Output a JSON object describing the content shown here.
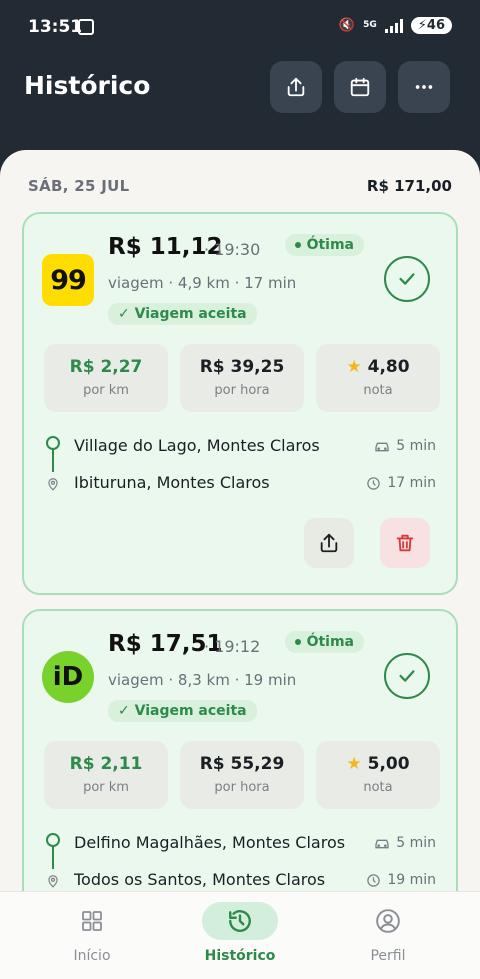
{
  "status_bar": {
    "time": "13:51",
    "network": "5G",
    "battery": "46"
  },
  "header": {
    "title": "Histórico",
    "share_icon": "share-icon",
    "calendar_icon": "calendar-icon",
    "more_icon": "more-horizontal-icon"
  },
  "day": {
    "label": "SÁB, 25 JUL",
    "total": "R$ 171,00"
  },
  "trips": [
    {
      "logo_text": "99",
      "price": "R$ 11,12",
      "time": "· 19:30",
      "quality": "Ótima",
      "meta": "viagem · 4,9 km · 17 min",
      "status": "✓ Viagem aceita",
      "stats": [
        {
          "value": "R$ 2,27",
          "label": "por km"
        },
        {
          "value": "R$ 39,25",
          "label": "por hora"
        },
        {
          "value": "4,80",
          "label": "nota"
        }
      ],
      "origin": "Village do Lago, Montes Claros",
      "origin_time": "5 min",
      "destination": "Ibituruna, Montes Claros",
      "destination_time": "17 min",
      "colors": {
        "accent": "#2d8a4a",
        "logo_bg": "#ffdd00"
      }
    },
    {
      "logo_text": "iD",
      "price": "R$ 17,51",
      "time": "· 19:12",
      "quality": "Ótima",
      "meta": "viagem · 8,3 km · 19 min",
      "status": "✓ Viagem aceita",
      "stats": [
        {
          "value": "R$ 2,11",
          "label": "por km"
        },
        {
          "value": "R$ 55,29",
          "label": "por hora"
        },
        {
          "value": "5,00",
          "label": "nota"
        }
      ],
      "origin": "Delfino Magalhães, Montes Claros",
      "origin_time": "5 min",
      "destination": "Todos os Santos, Montes Claros",
      "destination_time": "19 min",
      "colors": {
        "accent": "#2d8a4a",
        "logo_bg": "#78d22b"
      }
    }
  ],
  "nav": [
    {
      "label": "Início",
      "icon": "grid-icon"
    },
    {
      "label": "Histórico",
      "icon": "history-icon",
      "active": true
    },
    {
      "label": "Perfil",
      "icon": "profile-icon"
    }
  ]
}
